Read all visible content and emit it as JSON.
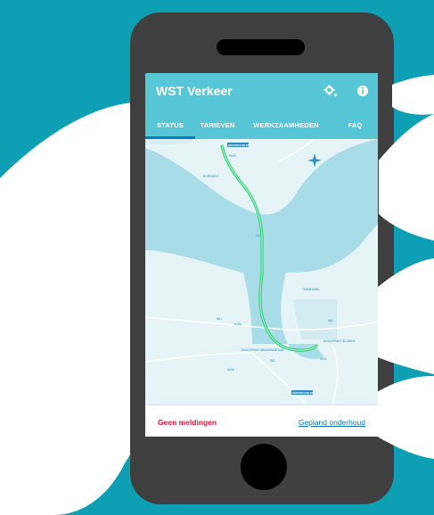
{
  "app": {
    "title": "WST Verkeer",
    "icons": {
      "settings": "gear-icon",
      "info": "info-icon"
    },
    "tabs": [
      {
        "label": "STATUS",
        "active": true
      },
      {
        "label": "TARIEVEN",
        "active": false
      },
      {
        "label": "WERKZAAMHEDEN",
        "active": false
      },
      {
        "label": "FAQ",
        "active": false
      }
    ]
  },
  "map": {
    "places": {
      "paal": "PAAL",
      "borssele": "BORSSELE",
      "terneuzen": "TERNEUZEN",
      "n61": "N61",
      "n62_upper": "N62",
      "n62_lower": "N62",
      "n258": "N258",
      "n253": "N253",
      "n61_right": "N61",
      "n291": "N291",
      "halfway": "N62",
      "viaduct_left": "KNOOPPUNT ABSCHEIDE A58?",
      "viaduct_right": "KNOOPPUNT SLUISKIL",
      "sign_top": "WESTERSCHELDE",
      "sign_bottom": "WESTERSCHELDE"
    },
    "compass": "compass-icon"
  },
  "footer": {
    "no_reports": "Geen meldingen",
    "planned_maintenance": "Gepland onderhoud"
  },
  "colors": {
    "background": "#0f9fb4",
    "phone": "#3f3f3f",
    "appbar": "#57c6d7",
    "tab_indicator": "#0b7bbf",
    "route": "#2fd07a",
    "alert": "#e0133c",
    "link": "#0d77a6"
  }
}
